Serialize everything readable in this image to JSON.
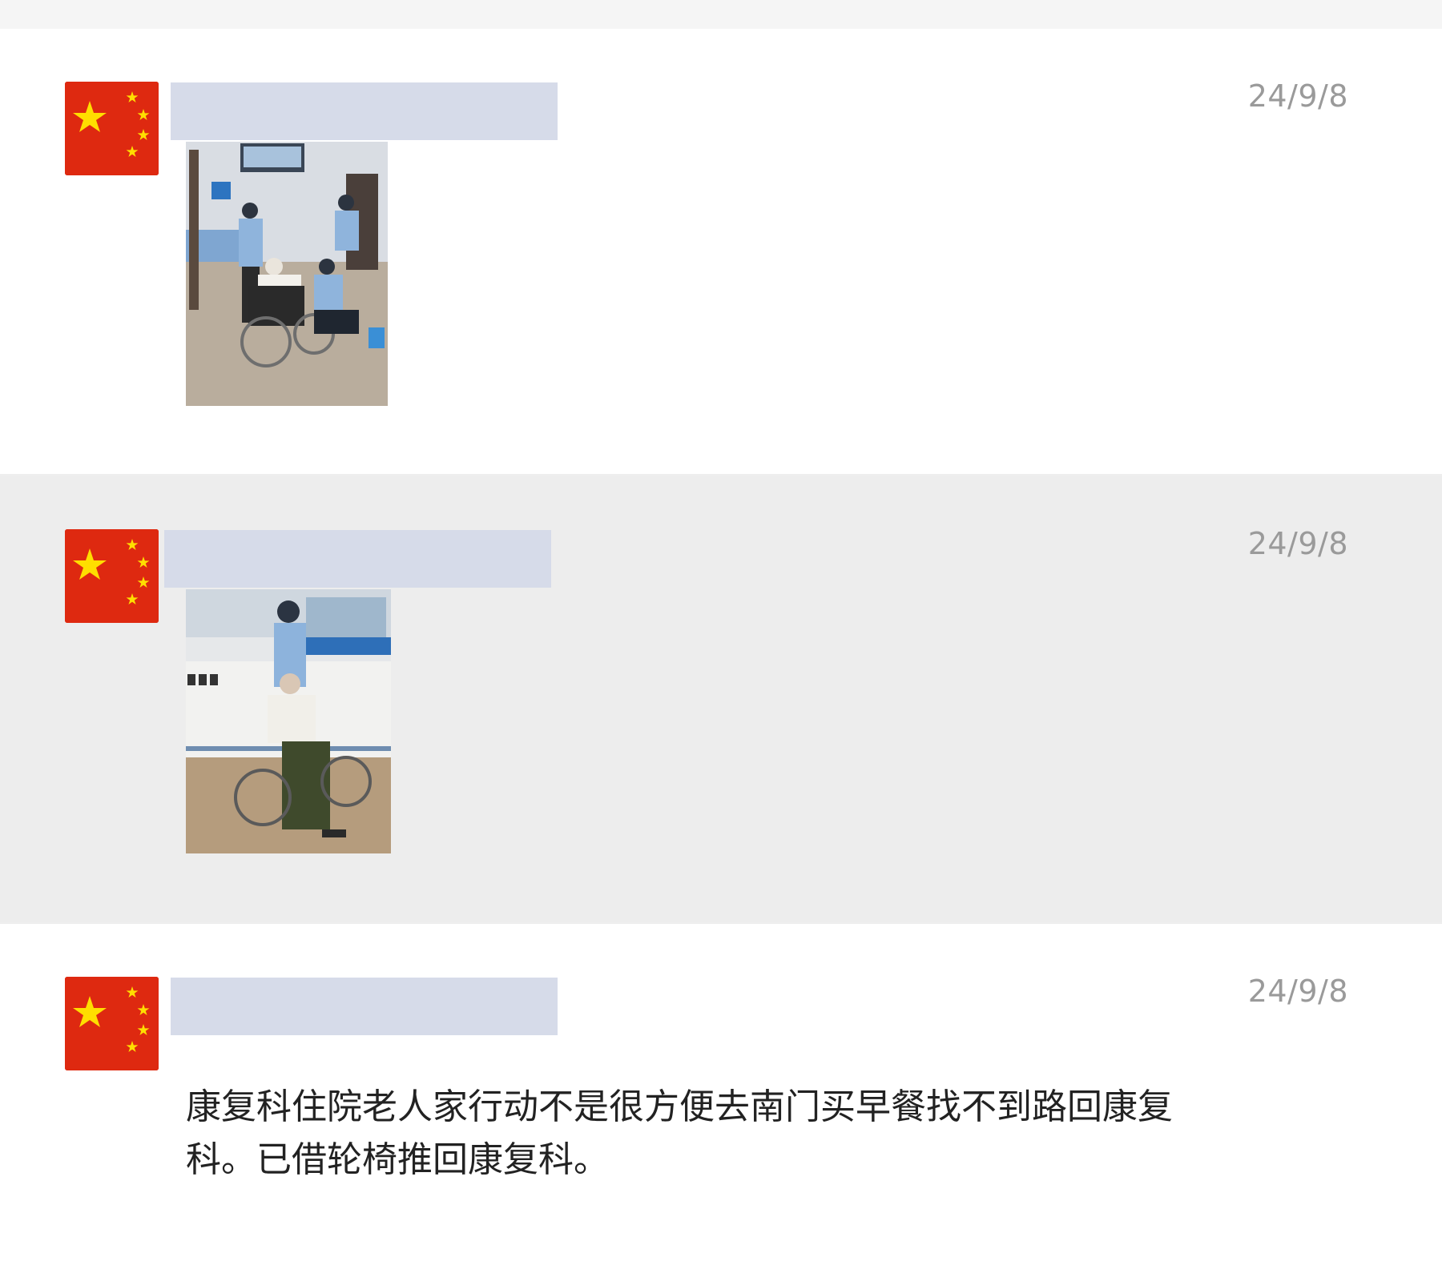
{
  "posts": [
    {
      "timestamp": "24/9/8",
      "type": "image",
      "avatar_icon": "china-flag-icon",
      "photo_icon": "hospital-police-wheelchair-photo"
    },
    {
      "timestamp": "24/9/8",
      "type": "image",
      "avatar_icon": "china-flag-icon",
      "photo_icon": "nurse-station-wheelchair-photo"
    },
    {
      "timestamp": "24/9/8",
      "type": "text",
      "avatar_icon": "china-flag-icon",
      "text": "康复科住院老人家行动不是很方便去南门买早餐找不到路回康复科。已借轮椅推回康复科。"
    }
  ],
  "colors": {
    "flag_red": "#de2910",
    "flag_yellow": "#ffde00",
    "highlight_bg": "#ededed",
    "redaction": "#d6dbe9",
    "timestamp_gray": "#9a9a9a"
  }
}
